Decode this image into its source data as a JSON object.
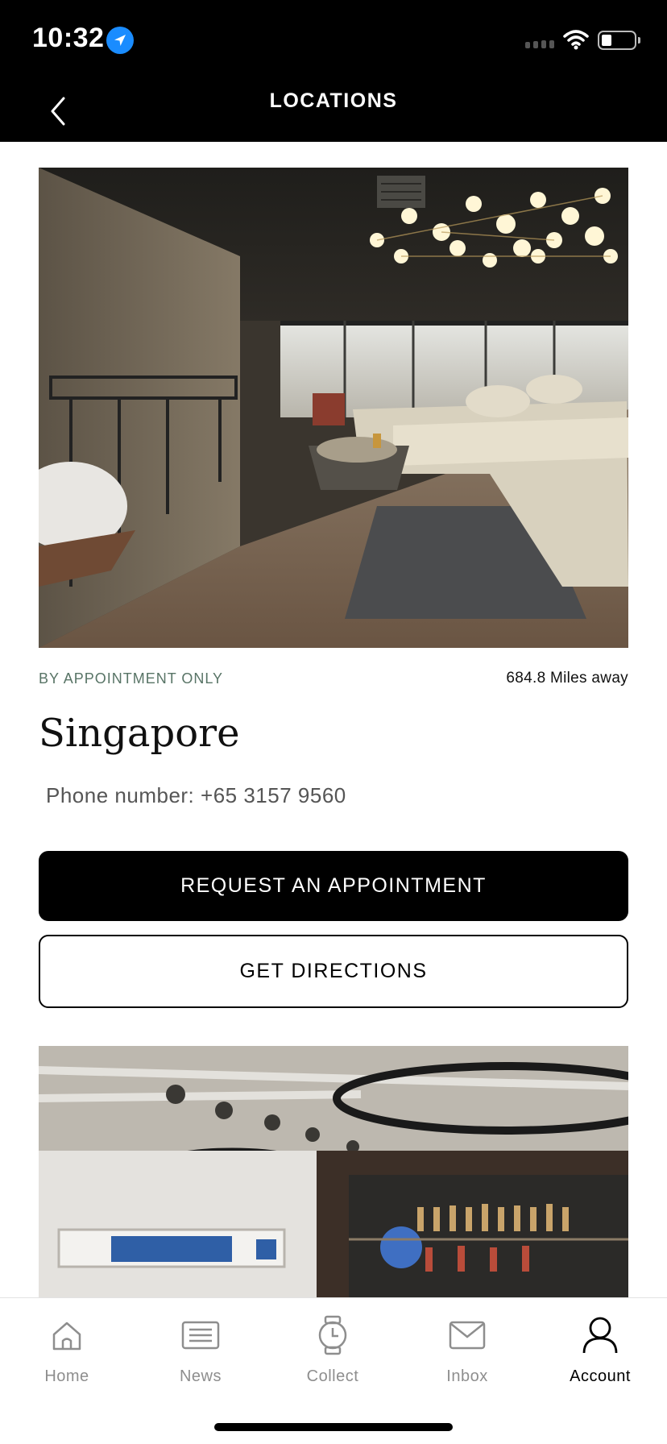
{
  "status_bar": {
    "time": "10:32",
    "location_icon": "location-arrow-icon",
    "wifi_icon": "wifi-icon",
    "battery_icon": "battery-icon",
    "accent_color": "#1a8cff"
  },
  "header": {
    "back_icon": "chevron-left-icon",
    "title": "LOCATIONS"
  },
  "location": {
    "badge": "BY APPOINTMENT ONLY",
    "distance": "684.8 Miles away",
    "name": "Singapore",
    "phone": "Phone number: +65 3157 9560",
    "badge_color": "#587466"
  },
  "actions": {
    "primary_label": "REQUEST AN APPOINTMENT",
    "secondary_label": "GET DIRECTIONS"
  },
  "tab_bar": {
    "items": [
      {
        "label": "Home",
        "icon": "home-icon",
        "active": false
      },
      {
        "label": "News",
        "icon": "news-icon",
        "active": false
      },
      {
        "label": "Collect",
        "icon": "watch-icon",
        "active": false
      },
      {
        "label": "Inbox",
        "icon": "mail-icon",
        "active": false
      },
      {
        "label": "Account",
        "icon": "user-icon",
        "active": true
      }
    ]
  }
}
